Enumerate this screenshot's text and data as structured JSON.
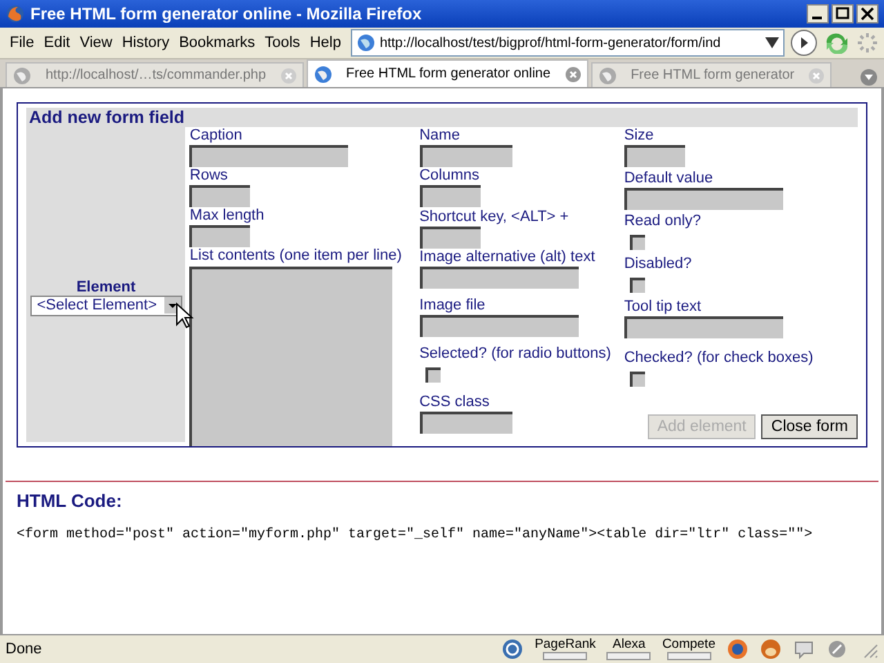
{
  "window": {
    "title": "Free HTML form generator online - Mozilla Firefox"
  },
  "menu": [
    "File",
    "Edit",
    "View",
    "History",
    "Bookmarks",
    "Tools",
    "Help"
  ],
  "address": {
    "value": "http://localhost/test/bigprof/html-form-generator/form/ind"
  },
  "tabs": [
    {
      "label": "http://localhost/…ts/commander.php",
      "selected": false
    },
    {
      "label": "Free HTML form generator online",
      "selected": true
    },
    {
      "label": "Free HTML form generator",
      "selected": false
    }
  ],
  "form": {
    "title": "Add new form field",
    "element": {
      "label": "Element",
      "value": "<Select Element>"
    },
    "columns": [
      [
        {
          "label": "Caption",
          "kind": "wide"
        },
        {
          "label": "Rows",
          "kind": "short"
        },
        {
          "label": "Max length",
          "kind": "short"
        },
        {
          "label": "List contents (one item per line)",
          "kind": "area"
        }
      ],
      [
        {
          "label": "Name",
          "kind": "medium"
        },
        {
          "label": "Columns",
          "kind": "short"
        },
        {
          "label": "Shortcut key, <ALT> +",
          "kind": "short"
        },
        {
          "label": "Image alternative (alt) text",
          "kind": "wide"
        },
        {
          "label": "Image file",
          "kind": "wide"
        },
        {
          "label": "Selected? (for radio buttons)",
          "kind": "checkbox",
          "checked": false
        },
        {
          "label": "CSS class",
          "kind": "medium"
        }
      ],
      [
        {
          "label": "Size",
          "kind": "short"
        },
        {
          "label": "Default value",
          "kind": "wide"
        },
        {
          "label": "Read only?",
          "kind": "checkbox",
          "checked": false
        },
        {
          "label": "Disabled?",
          "kind": "checkbox",
          "checked": false
        },
        {
          "label": "Tool tip text",
          "kind": "wide"
        },
        {
          "label": "Checked? (for check boxes)",
          "kind": "checkbox",
          "checked": false
        }
      ]
    ],
    "buttons": [
      {
        "label": "Add element",
        "disabled": true
      },
      {
        "label": "Close form",
        "disabled": false
      }
    ]
  },
  "code": {
    "heading": "HTML Code:",
    "text": "<form method=\"post\" action=\"myform.php\" target=\"_self\" name=\"anyName\"><table dir=\"ltr\" class=\"\">"
  },
  "status_bar": {
    "text": "Done",
    "meters": [
      "PageRank",
      "Alexa",
      "Compete"
    ]
  }
}
